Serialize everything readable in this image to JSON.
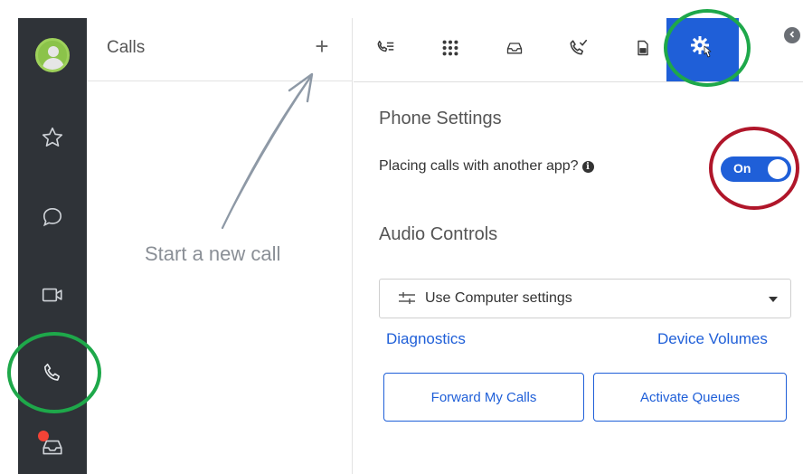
{
  "calls_panel": {
    "title": "Calls",
    "add_label": "+",
    "empty_state": "Start a new call"
  },
  "rail": {
    "items": [
      {
        "icon": "avatar"
      },
      {
        "icon": "star-icon"
      },
      {
        "icon": "chat-bubble-icon"
      },
      {
        "icon": "video-camera-icon"
      },
      {
        "icon": "phone-icon",
        "selected": true
      },
      {
        "icon": "inbox-icon",
        "badge": true
      }
    ]
  },
  "tabs": [
    {
      "icon": "call-list-icon"
    },
    {
      "icon": "dialpad-icon"
    },
    {
      "icon": "voicemail-tray-icon"
    },
    {
      "icon": "call-history-icon"
    },
    {
      "icon": "fax-icon"
    },
    {
      "icon": "settings-gear-icon",
      "active": true
    }
  ],
  "settings": {
    "phone_settings_title": "Phone Settings",
    "placing_calls_label": "Placing calls with another app?",
    "toggle_label": "On",
    "audio_controls_title": "Audio Controls",
    "audio_select_value": "Use Computer settings",
    "diagnostics_link": "Diagnostics",
    "device_volumes_link": "Device Volumes",
    "forward_button": "Forward My Calls",
    "queues_button": "Activate Queues"
  },
  "colors": {
    "accent": "#1f5fd8",
    "rail": "#2f3338",
    "annotation_green": "#1ea84a",
    "annotation_red": "#b0162a"
  }
}
